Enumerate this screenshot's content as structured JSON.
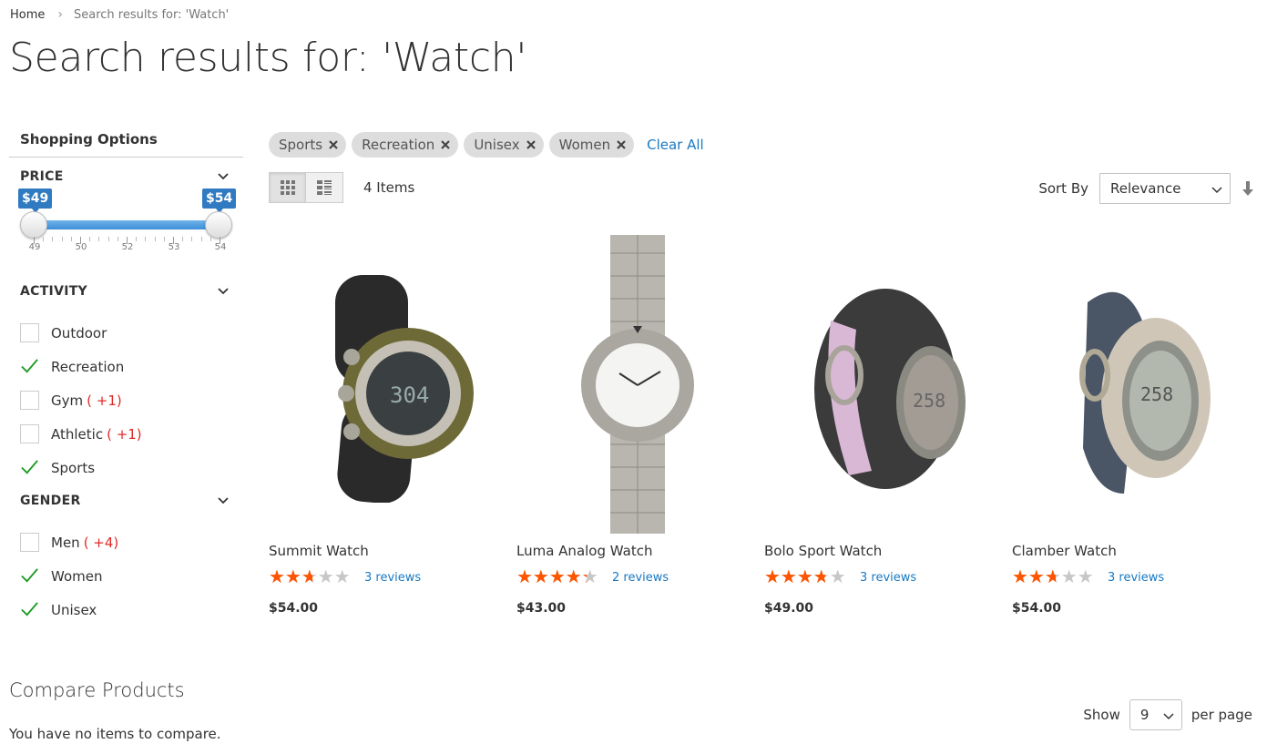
{
  "breadcrumb": {
    "home": "Home",
    "separator": "›",
    "current": "Search results for: 'Watch'"
  },
  "page_title": "Search results for: 'Watch'",
  "sidebar": {
    "title": "Shopping Options",
    "price": {
      "title": "PRICE",
      "min_label": "$49",
      "max_label": "$54",
      "min_value": 49,
      "max_value": 54,
      "scale_labels": [
        "49",
        "50",
        "52",
        "53",
        "54"
      ]
    },
    "activity": {
      "title": "ACTIVITY",
      "options": [
        {
          "label": "Outdoor",
          "checked": false,
          "count": ""
        },
        {
          "label": "Recreation",
          "checked": true,
          "count": ""
        },
        {
          "label": "Gym",
          "checked": false,
          "count": "( +1)"
        },
        {
          "label": "Athletic",
          "checked": false,
          "count": "( +1)"
        },
        {
          "label": "Sports",
          "checked": true,
          "count": ""
        }
      ]
    },
    "gender": {
      "title": "GENDER",
      "options": [
        {
          "label": "Men",
          "checked": false,
          "count": "( +4)"
        },
        {
          "label": "Women",
          "checked": true,
          "count": ""
        },
        {
          "label": "Unisex",
          "checked": true,
          "count": ""
        }
      ]
    }
  },
  "filters": {
    "chips": [
      "Sports",
      "Recreation",
      "Unisex",
      "Women"
    ],
    "clear_all": "Clear All"
  },
  "toolbar": {
    "items_count": "4 Items",
    "sort_label": "Sort By",
    "sort_value": "Relevance",
    "show_label": "Show",
    "limit_value": "9",
    "per_page": "per page"
  },
  "products": [
    {
      "name": "Summit Watch",
      "rating": 2.5,
      "reviews": "3 reviews",
      "price": "$54.00"
    },
    {
      "name": "Luma Analog Watch",
      "rating": 4,
      "reviews": "2 reviews",
      "price": "$43.00"
    },
    {
      "name": "Bolo Sport Watch",
      "rating": 3.5,
      "reviews": "3 reviews",
      "price": "$49.00"
    },
    {
      "name": "Clamber Watch",
      "rating": 2.5,
      "reviews": "3 reviews",
      "price": "$54.00"
    }
  ],
  "compare": {
    "title": "Compare Products",
    "empty": "You have no items to compare."
  },
  "colors": {
    "link": "#1979c3",
    "star": "#ff5501",
    "check": "#1f9b26",
    "price_badge": "#2f7ac1",
    "count": "#e02b27"
  }
}
